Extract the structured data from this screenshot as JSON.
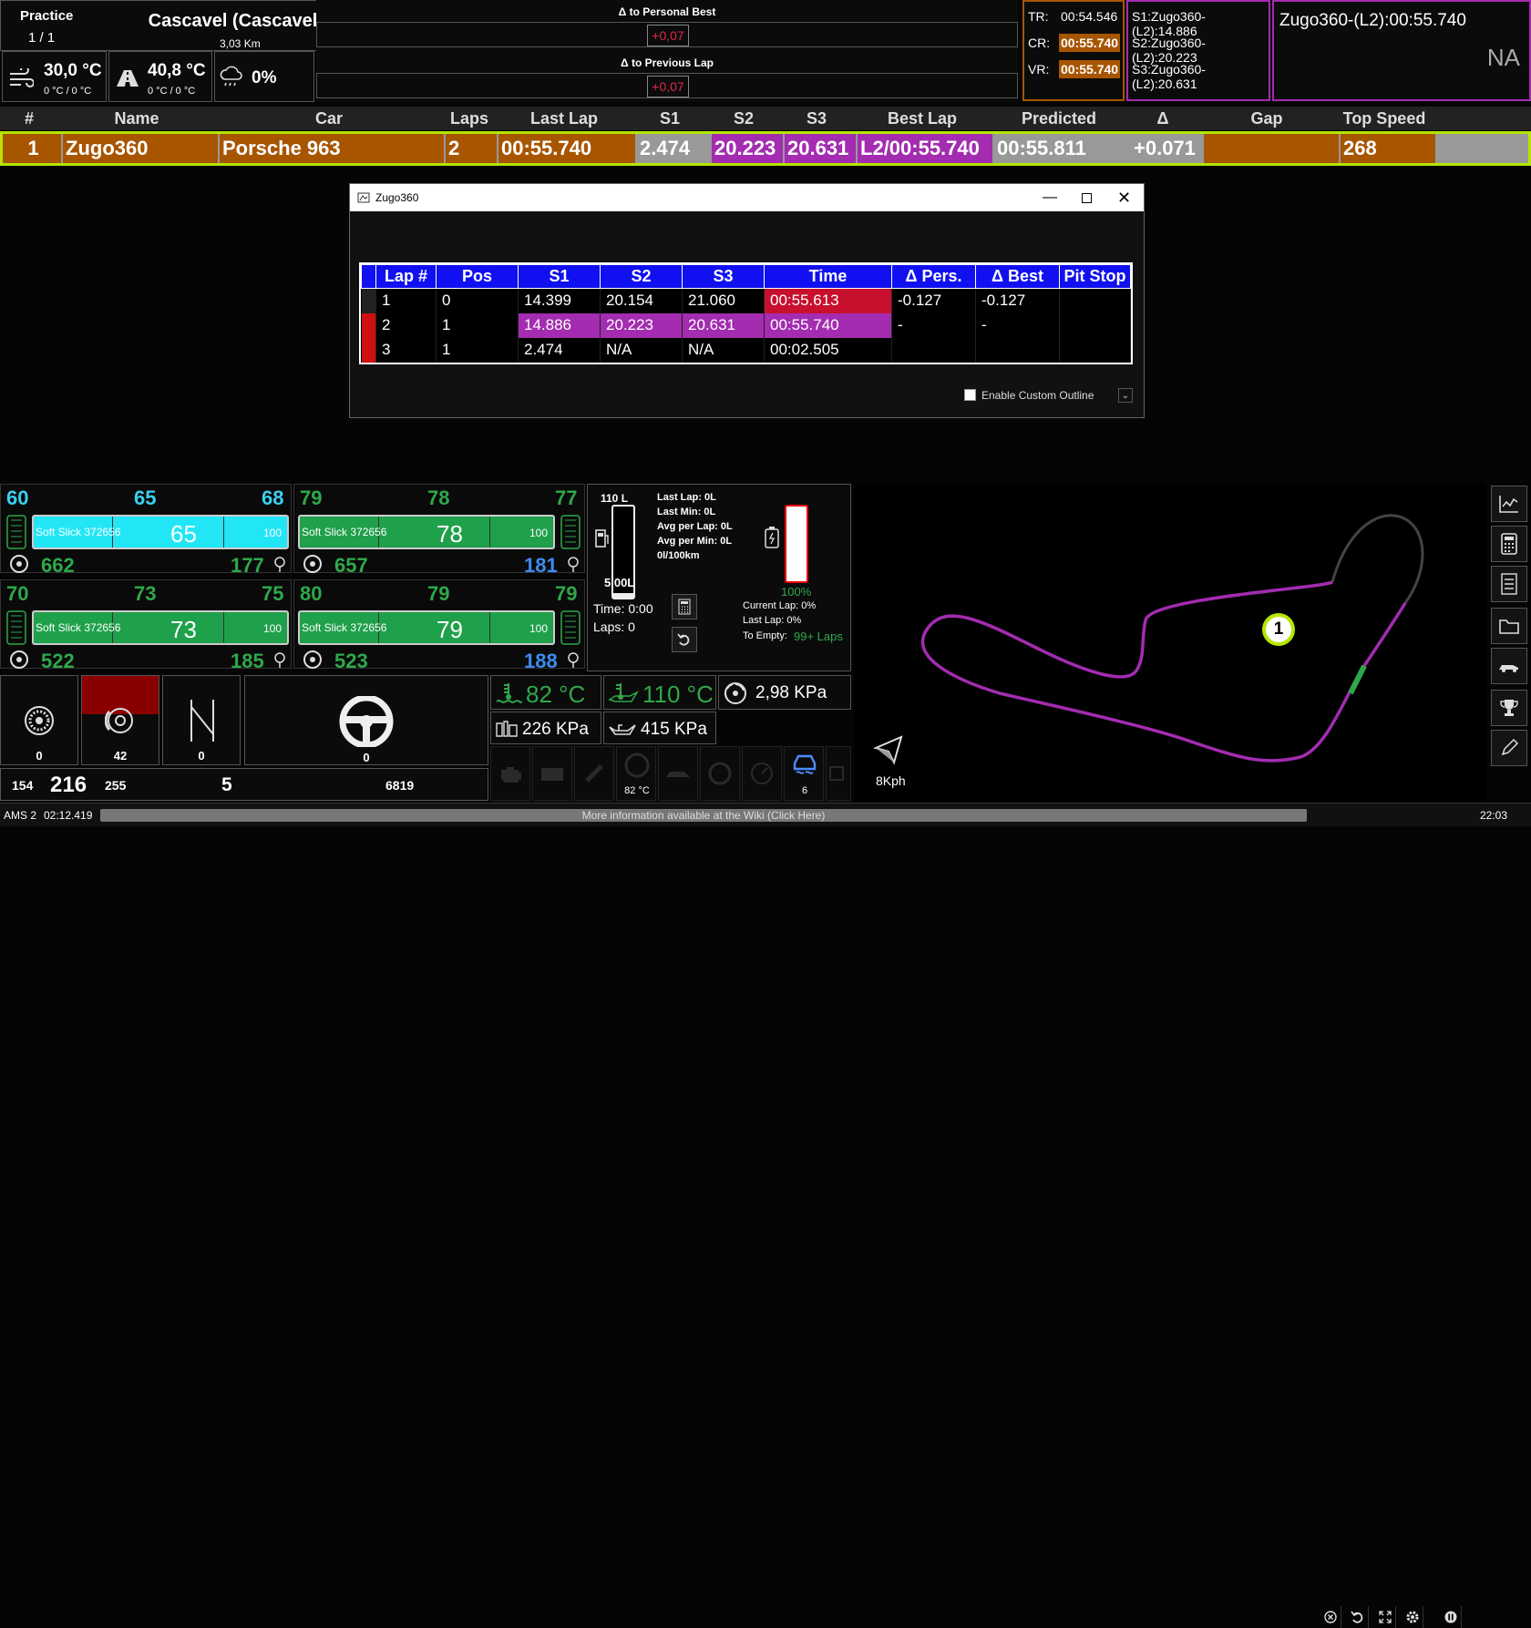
{
  "session": {
    "type": "Practice",
    "count": "1 / 1",
    "track": "Cascavel (Cascavel)",
    "length": "3,03 Km",
    "air_temp": "30,0 °C",
    "air_sub": "0 °C / 0 °C",
    "track_temp": "40,8 °C",
    "track_sub": "0 °C / 0 °C",
    "rain": "0%"
  },
  "delta": {
    "personal_label": "Δ to Personal Best",
    "personal_value": "+0,07",
    "previous_label": "Δ to Previous Lap",
    "previous_value": "+0,07"
  },
  "records": {
    "tr_label": "TR:",
    "tr_value": "00:54.546",
    "cr_label": "CR:",
    "cr_value": "00:55.740",
    "vr_label": "VR:",
    "vr_value": "00:55.740",
    "s1": "S1:Zugo360-(L2):14.886",
    "s2": "S2:Zugo360-(L2):20.223",
    "s3": "S3:Zugo360-(L2):20.631",
    "best": "Zugo360-(L2):00:55.740",
    "na": "NA"
  },
  "timing": {
    "headers": {
      "pos": "#",
      "name": "Name",
      "car": "Car",
      "laps": "Laps",
      "last": "Last Lap",
      "s1": "S1",
      "s2": "S2",
      "s3": "S3",
      "best": "Best Lap",
      "pred": "Predicted",
      "delta": "Δ",
      "gap": "Gap",
      "top": "Top Speed"
    },
    "row": {
      "pos": "1",
      "name": "Zugo360",
      "car": "Porsche 963",
      "laps": "2",
      "last": "00:55.740",
      "s1": "2.474",
      "s2": "20.223",
      "s3": "20.631",
      "best": "L2/00:55.740",
      "pred": "00:55.811",
      "delta": "+0.071",
      "gap": "",
      "top": "268"
    }
  },
  "window": {
    "title": "Zugo360",
    "checkbox": "Enable Custom Outline",
    "headers": [
      "Lap #",
      "Pos",
      "S1",
      "S2",
      "S3",
      "Time",
      "Δ Pers.",
      "Δ Best",
      "Pit Stop"
    ],
    "rows": [
      [
        "1",
        "0",
        "14.399",
        "20.154",
        "21.060",
        "00:55.613",
        "-0.127",
        "-0.127",
        ""
      ],
      [
        "2",
        "1",
        "14.886",
        "20.223",
        "20.631",
        "00:55.740",
        "-",
        "-",
        ""
      ],
      [
        "3",
        "1",
        "2.474",
        "N/A",
        "N/A",
        "00:02.505",
        "",
        "",
        ""
      ]
    ]
  },
  "tyres": {
    "fl": {
      "t1": "60",
      "t2": "65",
      "t3": "68",
      "label": "Soft Slick 372656",
      "value": "65",
      "max": "100",
      "brake": "662",
      "press": "177"
    },
    "fr": {
      "t1": "79",
      "t2": "78",
      "t3": "77",
      "label": "Soft Slick 372656",
      "value": "78",
      "max": "100",
      "brake": "657",
      "press": "181"
    },
    "rl": {
      "t1": "70",
      "t2": "73",
      "t3": "75",
      "label": "Soft Slick 372656",
      "value": "73",
      "max": "100",
      "brake": "522",
      "press": "185"
    },
    "rr": {
      "t1": "80",
      "t2": "79",
      "t3": "79",
      "label": "Soft Slick 372656",
      "value": "79",
      "max": "100",
      "brake": "523",
      "press": "188"
    }
  },
  "fuel": {
    "capacity": "110 L",
    "amount": "5,00L",
    "time": "Time: 0:00",
    "laps": "Laps: 0",
    "last_lap": "Last Lap: 0L",
    "last_min": "Last Min: 0L",
    "avg_lap": "Avg per Lap: 0L",
    "avg_min": "Avg per Min: 0L",
    "per100": "0l/100km",
    "battery": "100%",
    "cur_lap": "Current Lap: 0%",
    "last_lap_b": "Last Lap: 0%",
    "to_empty_label": "To Empty:",
    "to_empty_value": "99+ Laps"
  },
  "controls": {
    "abs": "0",
    "brake": "42",
    "gear_box": "0",
    "steer": "0",
    "g1": "154",
    "speed": "216",
    "g2": "255",
    "gear": "5",
    "rpm": "6819"
  },
  "engine": {
    "water": "82 °C",
    "oil": "110 °C",
    "turbo": "2,98 KPa",
    "fuel_press": "226 KPa",
    "oil_press": "415 KPa",
    "brake_temp": "82 °C",
    "tc": "6"
  },
  "map": {
    "marker": "1",
    "speed": "8Kph"
  },
  "status": {
    "app": "AMS 2",
    "time": "02:12.419",
    "info": "More information available at the Wiki (Click Here)",
    "clock": "22:03"
  },
  "colors": {
    "orange": "#a85500",
    "purple": "#a32cb0",
    "red": "#c8102e",
    "green": "#2ea84a",
    "cyan": "#22e6f6"
  }
}
